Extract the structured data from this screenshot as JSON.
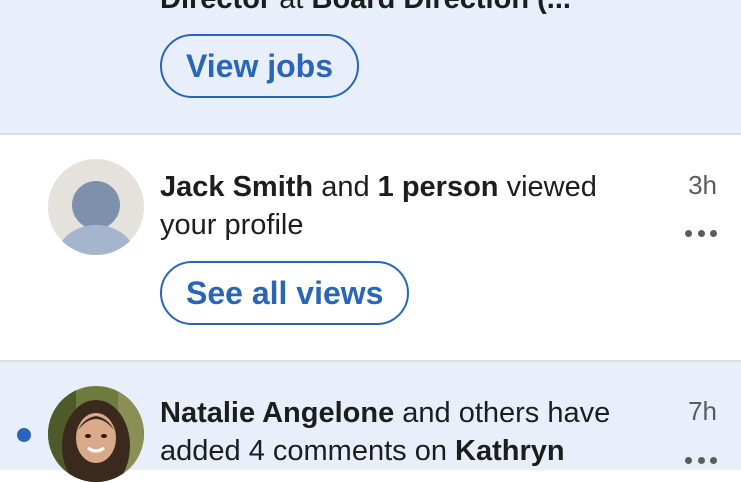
{
  "notifications": [
    {
      "id": "n1",
      "text_parts": [
        "Director",
        " at ",
        "Board Direction (..."
      ],
      "action_label": "View jobs"
    },
    {
      "id": "n2",
      "name": "Jack Smith",
      "mid1": " and ",
      "count": "1 person",
      "line1_end": " viewed",
      "line2": "your profile",
      "time": "3h",
      "action_label": "See all views",
      "avatar_icon": "default-person-icon"
    },
    {
      "id": "n3",
      "name": "Natalie Angelone",
      "line1_end": " and others have",
      "line2_start": "added 4 comments on ",
      "line2_bold": "Kathryn",
      "time": "7h",
      "avatar_icon": "user-photo",
      "unread_dot_color": "#2a66b8"
    }
  ],
  "colors": {
    "unread_bg": "#e8effa",
    "accent": "#2a66b8",
    "muted": "#5b5b5b"
  }
}
